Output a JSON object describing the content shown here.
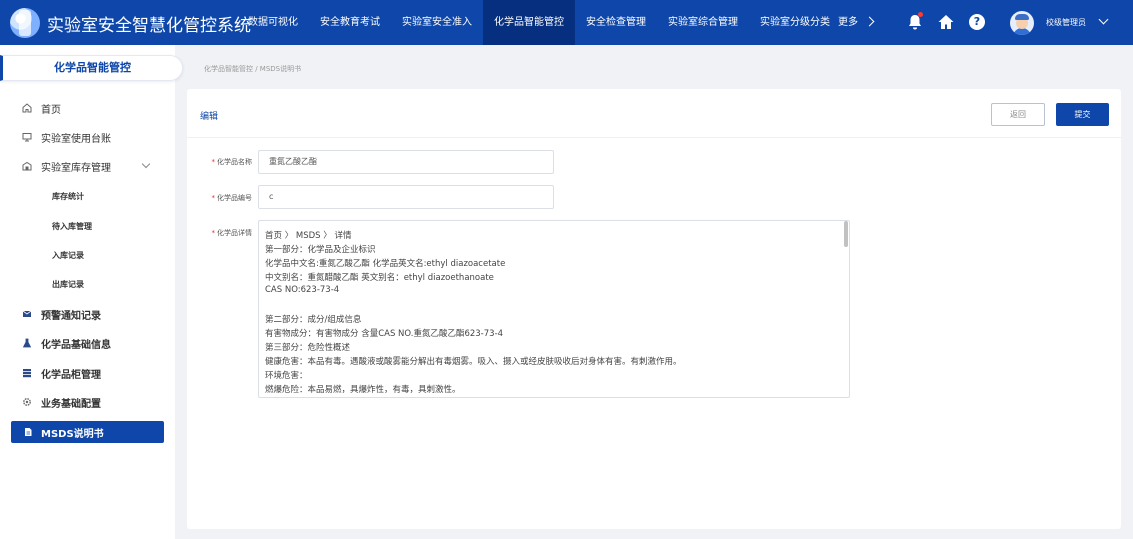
{
  "app": {
    "title": "实验室安全智慧化管控系统",
    "user_name": "校级管理员"
  },
  "nav": {
    "items": [
      {
        "label": "数据可视化"
      },
      {
        "label": "安全教育考试"
      },
      {
        "label": "实验室安全准入"
      },
      {
        "label": "化学品智能管控",
        "active": true
      },
      {
        "label": "安全检查管理"
      },
      {
        "label": "实验室综合管理"
      },
      {
        "label": "实验室分级分类"
      }
    ],
    "more_label": "更多"
  },
  "sidebar": {
    "header": "化学品智能管控",
    "items": [
      {
        "label": "首页",
        "icon": "home-icon"
      },
      {
        "label": "实验室使用台账",
        "icon": "monitor-icon"
      },
      {
        "label": "实验室库存管理",
        "icon": "warehouse-icon"
      },
      {
        "label": "预警通知记录",
        "icon": "alert-icon"
      },
      {
        "label": "化学品基础信息",
        "icon": "flask-icon"
      },
      {
        "label": "化学品柜管理",
        "icon": "cabinet-icon"
      },
      {
        "label": "业务基础配置",
        "icon": "gear-icon"
      },
      {
        "label": "MSDS说明书",
        "icon": "document-icon",
        "active": true
      }
    ],
    "sub_items": [
      {
        "label": "库存统计"
      },
      {
        "label": "待入库管理"
      },
      {
        "label": "入库记录"
      },
      {
        "label": "出库记录"
      }
    ]
  },
  "breadcrumb": "化学品智能管控 / MSDS说明书",
  "card": {
    "title": "编辑",
    "back_label": "返回",
    "submit_label": "提交"
  },
  "form": {
    "name_label": "化学品名称",
    "name_value": "重氮乙酸乙酯",
    "code_label": "化学品编号",
    "code_value": "c",
    "detail_label": "化学品详情",
    "detail_lines": [
      "首页 〉 MSDS 〉 详情",
      "第一部分：化学品及企业标识",
      "化学品中文名:重氮乙酸乙酯 化学品英文名:ethyl diazoacetate",
      "中文别名：重氮醋酸乙酯 英文别名：ethyl diazoethanoate",
      "CAS  NO:623-73-4",
      "",
      "第二部分：成分/组成信息",
      "有害物成分：有害物成分 含量CAS  NO.重氮乙酸乙酯623-73-4",
      "第三部分：危险性概述",
      "健康危害：本品有毒。遇酸液或酸雾能分解出有毒烟雾。吸入、摄入或经皮肤吸收后对身体有害。有刺激作用。",
      "环境危害：",
      "燃爆危险：本品易燃，具爆炸性，有毒，具刺激性。"
    ]
  },
  "colors": {
    "primary": "#0e47a9",
    "primary_dark": "#062f80",
    "required": "#f5222d"
  }
}
